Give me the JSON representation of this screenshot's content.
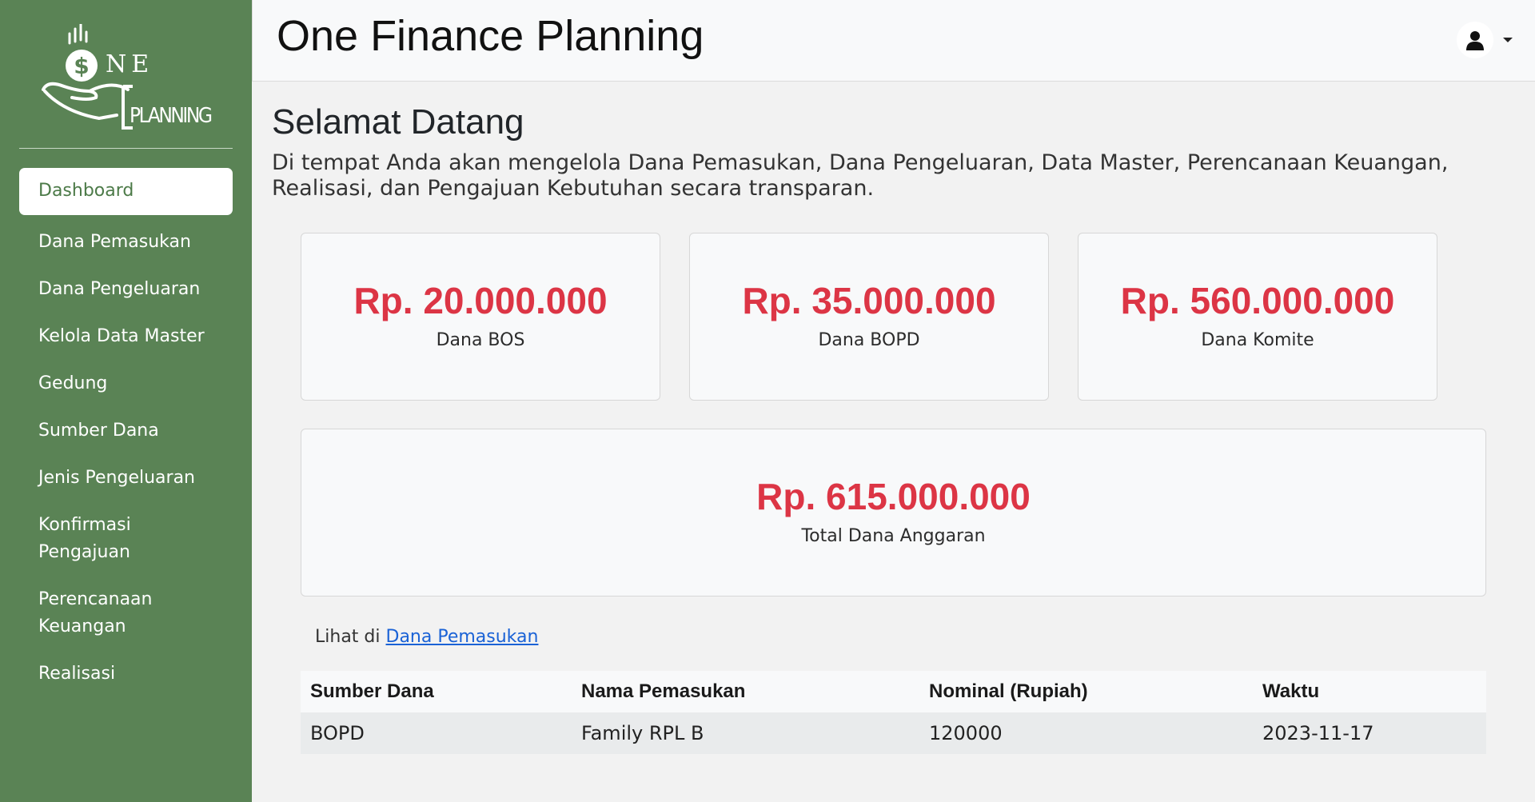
{
  "logo": {
    "text_top": "NE",
    "text_bottom": "PLANNING",
    "symbol": "$"
  },
  "sidebar": {
    "items": [
      {
        "label": "Dashboard",
        "active": true
      },
      {
        "label": "Dana Pemasukan"
      },
      {
        "label": "Dana Pengeluaran"
      },
      {
        "label": "Kelola Data Master"
      },
      {
        "label": "Gedung"
      },
      {
        "label": "Sumber Dana"
      },
      {
        "label": "Jenis Pengeluaran"
      },
      {
        "label": "Konfirmasi Pengajuan"
      },
      {
        "label": "Perencanaan Keuangan"
      },
      {
        "label": "Realisasi"
      }
    ]
  },
  "header": {
    "title": "One Finance Planning",
    "user_icon": "user-icon"
  },
  "main": {
    "welcome_title": "Selamat Datang",
    "welcome_text": "Di tempat Anda akan mengelola Dana Pemasukan, Dana Pengeluaran, Data Master, Perencanaan Keuangan, Realisasi, dan Pengajuan Kebutuhan secara transparan.",
    "cards": [
      {
        "amount": "Rp. 20.000.000",
        "label": "Dana BOS"
      },
      {
        "amount": "Rp. 35.000.000",
        "label": "Dana BOPD"
      },
      {
        "amount": "Rp. 560.000.000",
        "label": "Dana Komite"
      }
    ],
    "total": {
      "amount": "Rp. 615.000.000",
      "label": "Total Dana Anggaran"
    },
    "see_more": {
      "prefix": "Lihat di",
      "link": "Dana Pemasukan"
    },
    "table": {
      "headers": [
        "Sumber Dana",
        "Nama Pemasukan",
        "Nominal (Rupiah)",
        "Waktu"
      ],
      "rows": [
        [
          "BOPD",
          "Family RPL B",
          "120000",
          "2023-11-17"
        ]
      ]
    }
  },
  "colors": {
    "sidebar": "#5a8355",
    "accent_red": "#dc3545",
    "link": "#1a62d6"
  }
}
